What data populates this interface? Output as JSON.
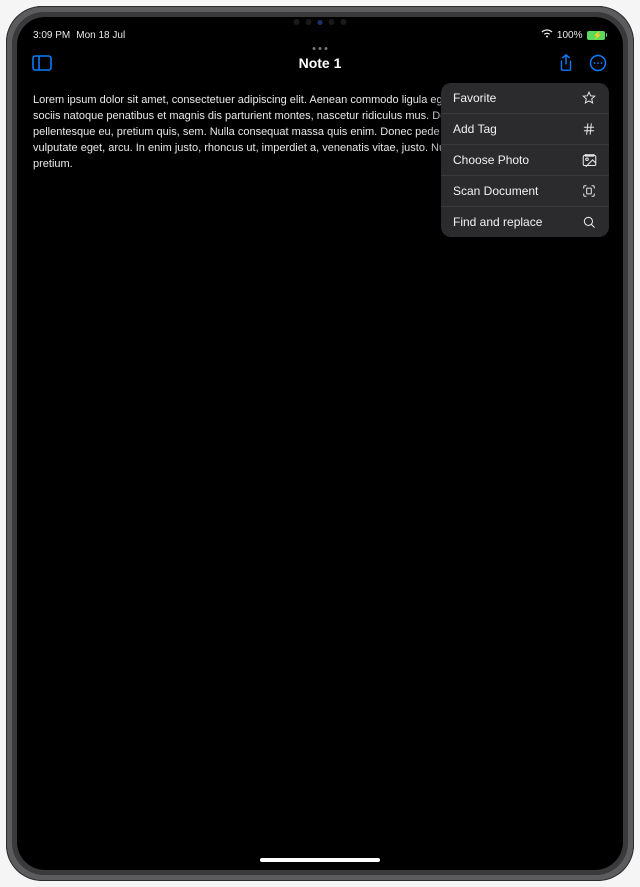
{
  "status": {
    "time": "3:09 PM",
    "date": "Mon 18 Jul",
    "battery_pct": "100%"
  },
  "nav": {
    "title": "Note 1"
  },
  "note": {
    "body": "Lorem ipsum dolor sit amet, consectetuer adipiscing elit. Aenean commodo ligula eget dolor. Aenean massa. Cum sociis natoque penatibus et magnis dis parturient montes, nascetur ridiculus mus. Donec quam felis, ultricies nec, pellentesque eu, pretium quis, sem. Nulla consequat massa quis enim. Donec pede justo, fringilla vel, aliquet nec, vulputate eget, arcu. In enim justo, rhoncus ut, imperdiet a, venenatis vitae, justo. Nullam dictum felis eu pede mollis pretium."
  },
  "menu": {
    "items": [
      {
        "label": "Favorite",
        "icon": "star-icon"
      },
      {
        "label": "Add Tag",
        "icon": "hash-icon"
      },
      {
        "label": "Choose Photo",
        "icon": "photo-icon"
      },
      {
        "label": "Scan Document",
        "icon": "scan-icon"
      },
      {
        "label": "Find and replace",
        "icon": "search-icon"
      }
    ]
  }
}
